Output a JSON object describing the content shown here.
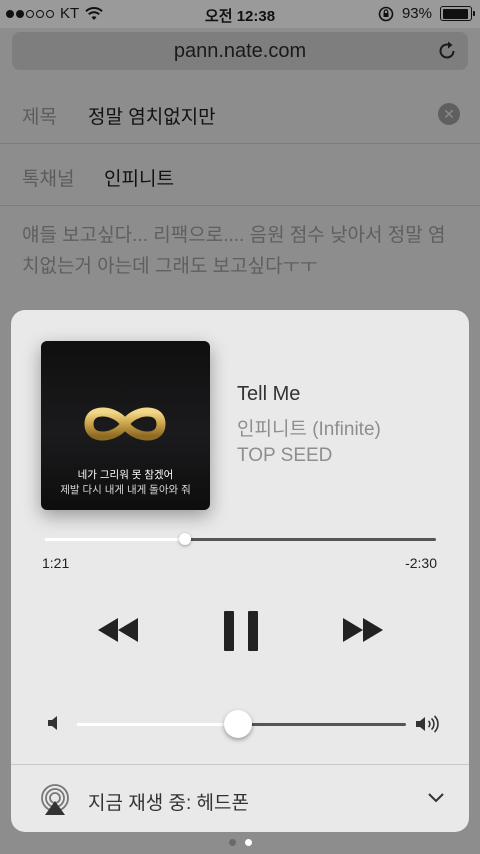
{
  "status_bar": {
    "carrier": "KT",
    "time": "오전 12:38",
    "battery": "93%",
    "battery_level": 0.93,
    "signal_bars": 2,
    "icons": [
      "signal-dots-icon",
      "wifi-icon",
      "rotation-lock-icon",
      "battery-icon"
    ]
  },
  "browser": {
    "url": "pann.nate.com",
    "reload_icon": "reload-icon"
  },
  "form": {
    "title_label": "제목",
    "title_value": "정말 염치없지만",
    "channel_label": "톡채널",
    "channel_value": "인피니트",
    "body_text": "얘들 보고싶다... 리팩으로.... 음원 점수 낮아서 정말 염치없는거 아는데 그래도 보고싶다ㅜㅜ",
    "clear_icon": "clear-icon"
  },
  "now_playing": {
    "album_art": {
      "line1": "네가 그리워 못 참겠어",
      "line2": "제발 다시 내게 내게 돌아와 줘",
      "logo_icon": "infinity-logo"
    },
    "title": "Tell Me",
    "artist": "인피니트 (Infinite)",
    "album": "TOP SEED",
    "progress_fraction": 0.36,
    "time_elapsed": "1:21",
    "time_remaining": "-2:30",
    "volume_fraction": 0.49,
    "airplay_label": "지금 재생 중: 헤드폰",
    "accent_color": "#ffffff",
    "track_color": "#555555"
  },
  "page_indicator": {
    "count": 2,
    "active_index": 1
  }
}
